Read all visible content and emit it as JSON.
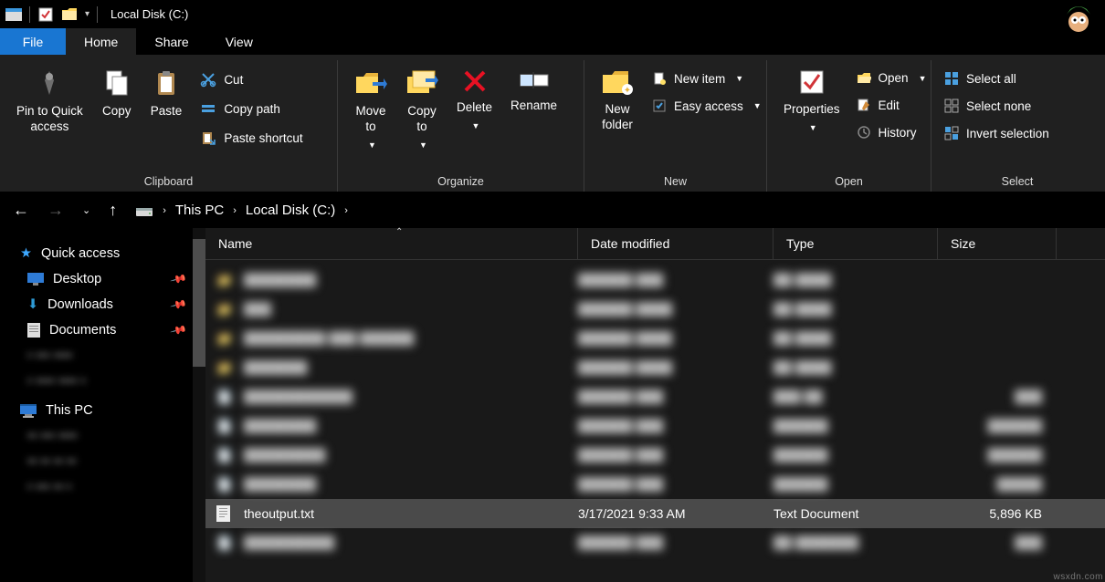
{
  "title": "Local Disk (C:)",
  "menu": {
    "file": "File",
    "home": "Home",
    "share": "Share",
    "view": "View"
  },
  "ribbon": {
    "clipboard": {
      "label": "Clipboard",
      "pin": "Pin to Quick\naccess",
      "copy": "Copy",
      "paste": "Paste",
      "cut": "Cut",
      "copypath": "Copy path",
      "pasteshortcut": "Paste shortcut"
    },
    "organize": {
      "label": "Organize",
      "moveto": "Move\nto",
      "copyto": "Copy\nto",
      "delete": "Delete",
      "rename": "Rename"
    },
    "new": {
      "label": "New",
      "newfolder": "New\nfolder",
      "newitem": "New item",
      "easyaccess": "Easy access"
    },
    "open": {
      "label": "Open",
      "properties": "Properties",
      "open": "Open",
      "edit": "Edit",
      "history": "History"
    },
    "select": {
      "label": "Select",
      "all": "Select all",
      "none": "Select none",
      "invert": "Invert selection"
    }
  },
  "breadcrumb": {
    "thispc": "This PC",
    "loc": "Local Disk (C:)"
  },
  "sidebar": {
    "quick": "Quick access",
    "desktop": "Desktop",
    "downloads": "Downloads",
    "documents": "Documents",
    "thispc": "This PC"
  },
  "columns": {
    "name": "Name",
    "date": "Date modified",
    "type": "Type",
    "size": "Size"
  },
  "selected": {
    "name": "theoutput.txt",
    "date": "3/17/2021 9:33 AM",
    "type": "Text Document",
    "size": "5,896 KB"
  },
  "watermark": "wsxdn.com"
}
